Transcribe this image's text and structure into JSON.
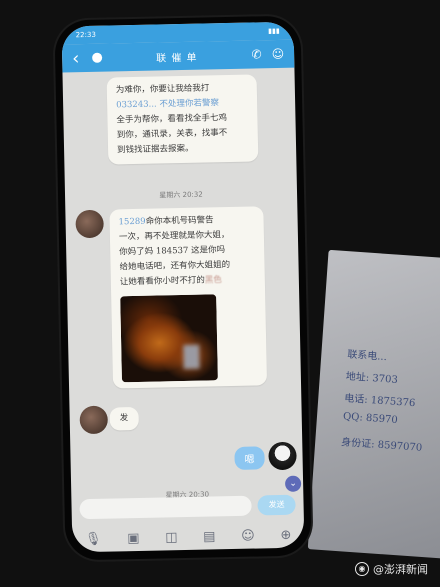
{
  "status_bar": {
    "time": "22:33",
    "carrier": "信号",
    "battery": ""
  },
  "header": {
    "back_icon": "back-arrow-icon",
    "unread_badge": "",
    "contact_name": "联 催     单 ",
    "call_icon": "phone-icon",
    "profile_icon": "person-icon"
  },
  "messages": [
    {
      "side": "left",
      "text_lines": [
        "为难你，你要让我给我打",
        "033243... 不处理你若警察",
        "全手为帮你，看看找全手七鸡",
        "到你，通讯录，关表，找事不",
        "到钱找证据去报案。"
      ]
    },
    {
      "timestamp": "星期六 20:32"
    },
    {
      "side": "left",
      "phone_prefix": "15289",
      "text_lines": [
        "命你本机号码警告",
        "一次，再不处理就是你大姐，",
        "你妈了妈 184537 这是你吗",
        "给她电话吧，还有你大姐姐的",
        "让她看看你小时不打的"
      ],
      "phone2": "184537",
      "blurred": "黑色",
      "has_photo": true
    },
    {
      "side": "left",
      "text": "发"
    },
    {
      "side": "right",
      "text": "嗯"
    },
    {
      "timestamp": "星期六 20:30"
    }
  ],
  "input": {
    "placeholder": "",
    "send_label": "发送"
  },
  "toolbar_icons": [
    "mic-icon",
    "image-icon",
    "camera-icon",
    "red-packet-icon",
    "emoji-icon",
    "plus-icon"
  ],
  "paper_lines": [
    "联系电...",
    "地址: 3703",
    "电话: 1875376",
    "QQ: 85970",
    "身份证: 8597070"
  ],
  "watermark": {
    "text": "@澎湃新闻"
  }
}
